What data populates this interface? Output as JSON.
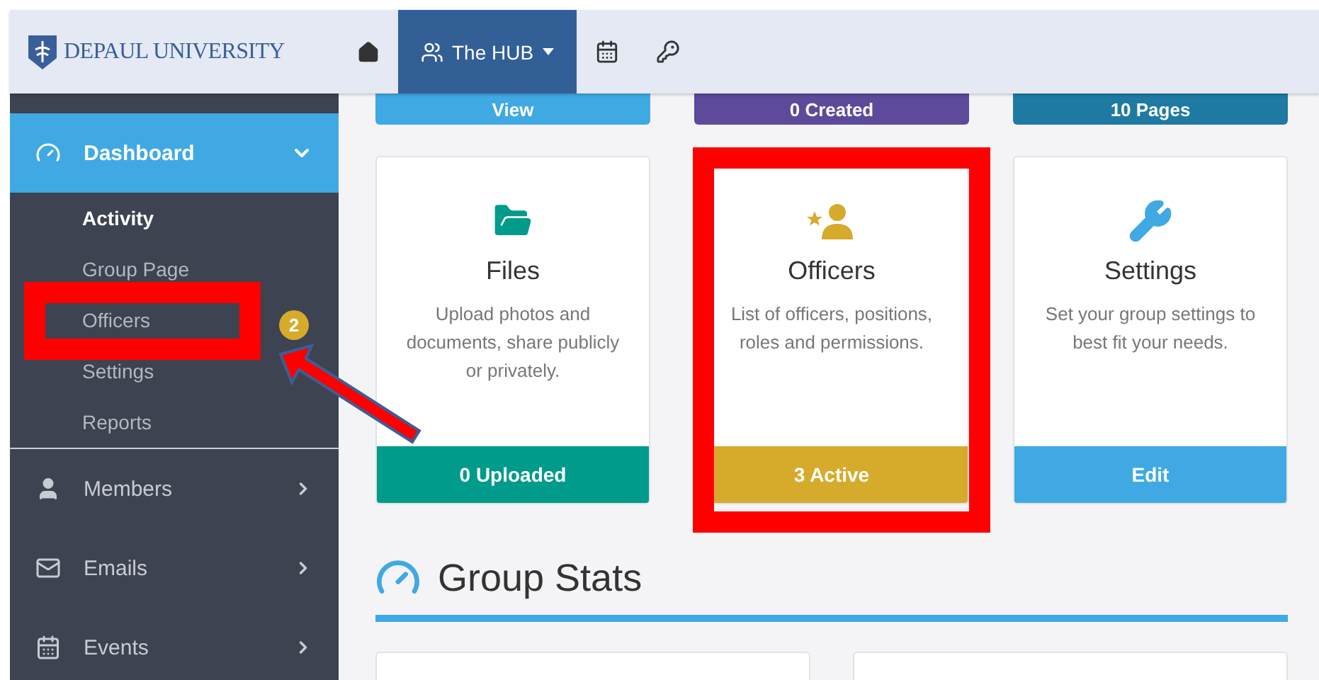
{
  "header": {
    "logo_text": "DEPAUL UNIVERSITY",
    "nav": [
      {
        "kind": "home",
        "selected": false
      },
      {
        "kind": "group",
        "label": "The HUB",
        "selected": true
      },
      {
        "kind": "calendar",
        "selected": false
      },
      {
        "kind": "key",
        "selected": false
      }
    ]
  },
  "sidebar": {
    "items": [
      {
        "kind": "gauge",
        "label": "Dashboard",
        "selected": true,
        "expanded": true,
        "children": [
          {
            "label": "Activity",
            "selected": true
          },
          {
            "label": "Group Page",
            "selected": false
          },
          {
            "label": "Officers",
            "selected": false
          },
          {
            "label": "Settings",
            "selected": false
          },
          {
            "label": "Reports",
            "selected": false
          }
        ]
      },
      {
        "kind": "person",
        "label": "Members",
        "selected": false,
        "expanded": false
      },
      {
        "kind": "mail",
        "label": "Emails",
        "selected": false,
        "expanded": false
      },
      {
        "kind": "calendar",
        "label": "Events",
        "selected": false,
        "expanded": false
      }
    ]
  },
  "top_cards": [
    {
      "footer": "View",
      "color": "#3fa9e3"
    },
    {
      "footer": "0 Created",
      "color": "#5d4a9b"
    },
    {
      "footer": "10 Pages",
      "color": "#1f7aa3"
    }
  ],
  "cards": [
    {
      "kind": "folder",
      "title": "Files",
      "description": "Upload photos and documents, share publicly or privately.",
      "footer": "0 Uploaded",
      "color": "#009b8a"
    },
    {
      "kind": "officer",
      "title": "Officers",
      "description": "List of officers, positions, roles and permissions.",
      "footer": "3 Active",
      "color": "#d6aa2b"
    },
    {
      "kind": "wrench",
      "title": "Settings",
      "description": "Set your group settings to best fit your needs.",
      "footer": "Edit",
      "color": "#40a9e3"
    }
  ],
  "section": {
    "title": "Group Stats"
  },
  "annotations": {
    "badge": "2"
  }
}
